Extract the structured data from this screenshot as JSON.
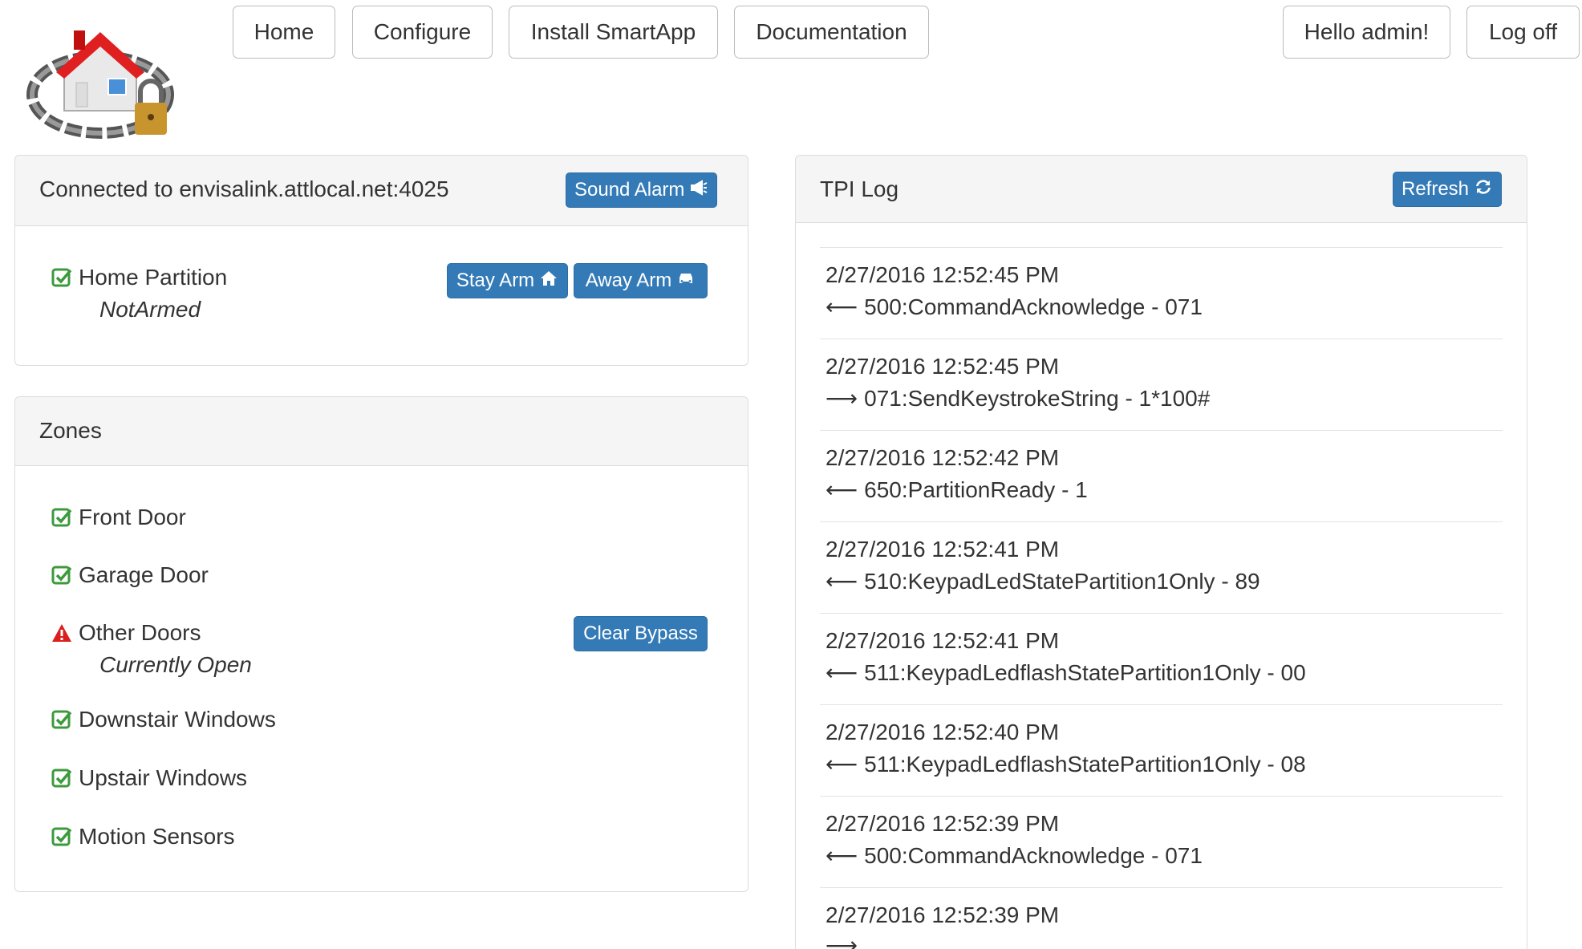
{
  "nav": {
    "home": "Home",
    "configure": "Configure",
    "install": "Install SmartApp",
    "docs": "Documentation",
    "hello": "Hello admin!",
    "logoff": "Log off"
  },
  "connection": {
    "title": "Connected to envisalink.attlocal.net:4025",
    "sound_alarm": "Sound Alarm",
    "partition_name": "Home Partition",
    "partition_status": "NotArmed",
    "stay_arm": "Stay Arm",
    "away_arm": "Away Arm"
  },
  "zones": {
    "title": "Zones",
    "items": [
      {
        "name": "Front Door",
        "status": "ok"
      },
      {
        "name": "Garage Door",
        "status": "ok"
      },
      {
        "name": "Other Doors",
        "status": "warning",
        "detail": "Currently Open",
        "action": "Clear Bypass"
      },
      {
        "name": "Downstair Windows",
        "status": "ok"
      },
      {
        "name": "Upstair Windows",
        "status": "ok"
      },
      {
        "name": "Motion Sensors",
        "status": "ok"
      }
    ]
  },
  "log": {
    "title": "TPI Log",
    "refresh": "Refresh",
    "entries": [
      {
        "time": "2/27/2016 12:52:45 PM",
        "dir": "in",
        "msg": "500:CommandAcknowledge - 071"
      },
      {
        "time": "2/27/2016 12:52:45 PM",
        "dir": "out",
        "msg": "071:SendKeystrokeString - 1*100#"
      },
      {
        "time": "2/27/2016 12:52:42 PM",
        "dir": "in",
        "msg": "650:PartitionReady - 1"
      },
      {
        "time": "2/27/2016 12:52:41 PM",
        "dir": "in",
        "msg": "510:KeypadLedStatePartition1Only - 89"
      },
      {
        "time": "2/27/2016 12:52:41 PM",
        "dir": "in",
        "msg": "511:KeypadLedflashStatePartition1Only - 00"
      },
      {
        "time": "2/27/2016 12:52:40 PM",
        "dir": "in",
        "msg": "511:KeypadLedflashStatePartition1Only - 08"
      },
      {
        "time": "2/27/2016 12:52:39 PM",
        "dir": "in",
        "msg": "500:CommandAcknowledge - 071"
      },
      {
        "time": "2/27/2016 12:52:39 PM",
        "dir": "out",
        "msg": ""
      }
    ]
  },
  "colors": {
    "primary": "#337ab7",
    "ok": "#3c9a3c",
    "warning": "#d9201c"
  }
}
